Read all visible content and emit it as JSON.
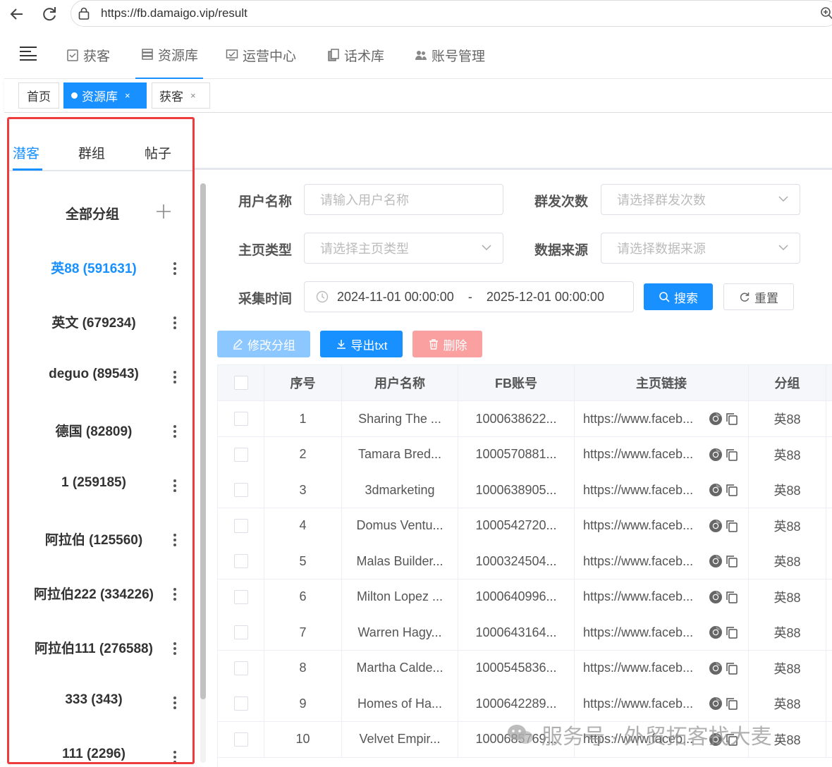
{
  "browser": {
    "url": "https://fb.damaigo.vip/result"
  },
  "topnav": {
    "items": [
      {
        "label": "获客",
        "icon": "clipboard-check-icon"
      },
      {
        "label": "资源库",
        "icon": "database-icon"
      },
      {
        "label": "运营中心",
        "icon": "monitor-check-icon"
      },
      {
        "label": "话术库",
        "icon": "document-icon"
      },
      {
        "label": "账号管理",
        "icon": "users-icon"
      }
    ],
    "active_index": 1
  },
  "tags": {
    "home": "首页",
    "resource": "资源库",
    "acquire": "获客",
    "close": "×"
  },
  "left_panel": {
    "tabs": [
      "潜客",
      "群组",
      "帖子"
    ],
    "active_tab": 0,
    "all_groups": "全部分组",
    "groups": [
      "英88 (591631)",
      "英文 (679234)",
      "deguo (89543)",
      "德国 (82809)",
      "1 (259185)",
      "阿拉伯 (125560)",
      "阿拉伯222 (334226)",
      "阿拉伯111 (276588)",
      "333 (343)",
      "111 (2296)"
    ],
    "active_group": 0
  },
  "filters": {
    "username_label": "用户名称",
    "username_placeholder": "请输入用户名称",
    "mass_count_label": "群发次数",
    "mass_count_placeholder": "请选择群发次数",
    "page_type_label": "主页类型",
    "page_type_placeholder": "请选择主页类型",
    "data_source_label": "数据来源",
    "data_source_placeholder": "请选择数据来源",
    "collect_time_label": "采集时间",
    "date_start": "2024-11-01 00:00:00",
    "date_sep": "-",
    "date_end": "2025-12-01 00:00:00",
    "search": "搜索",
    "reset": "重置"
  },
  "actions": {
    "edit_group": "修改分组",
    "export_txt": "导出txt",
    "delete": "删除"
  },
  "table": {
    "headers": [
      "序号",
      "用户名称",
      "FB账号",
      "主页链接",
      "分组"
    ],
    "rows": [
      {
        "no": "1",
        "name": "Sharing The ...",
        "fb": "1000638622...",
        "link": "https://www.faceb...",
        "group": "英88"
      },
      {
        "no": "2",
        "name": "Tamara Bred...",
        "fb": "1000570881...",
        "link": "https://www.faceb...",
        "group": "英88"
      },
      {
        "no": "3",
        "name": "3dmarketing",
        "fb": "1000638905...",
        "link": "https://www.faceb...",
        "group": "英88"
      },
      {
        "no": "4",
        "name": "Domus Ventu...",
        "fb": "1000542720...",
        "link": "https://www.faceb...",
        "group": "英88"
      },
      {
        "no": "5",
        "name": "Malas Builder...",
        "fb": "1000324504...",
        "link": "https://www.faceb...",
        "group": "英88"
      },
      {
        "no": "6",
        "name": "Milton Lopez ...",
        "fb": "1000640996...",
        "link": "https://www.faceb...",
        "group": "英88"
      },
      {
        "no": "7",
        "name": "Warren Hagy...",
        "fb": "1000643164...",
        "link": "https://www.faceb...",
        "group": "英88"
      },
      {
        "no": "8",
        "name": "Martha Calde...",
        "fb": "1000545836...",
        "link": "https://www.faceb...",
        "group": "英88"
      },
      {
        "no": "9",
        "name": "Homes of Ha...",
        "fb": "1000642289...",
        "link": "https://www.faceb...",
        "group": "英88"
      },
      {
        "no": "10",
        "name": "Velvet Empir...",
        "fb": "1000685769...",
        "link": "https://www.faceb...",
        "group": "英88"
      }
    ]
  },
  "watermark": {
    "text": "服务号 · 外贸拓客找大麦"
  },
  "colors": {
    "primary": "#1890ff",
    "highlight_border": "#ee3b3b",
    "danger_disabled": "#fba0a0"
  }
}
